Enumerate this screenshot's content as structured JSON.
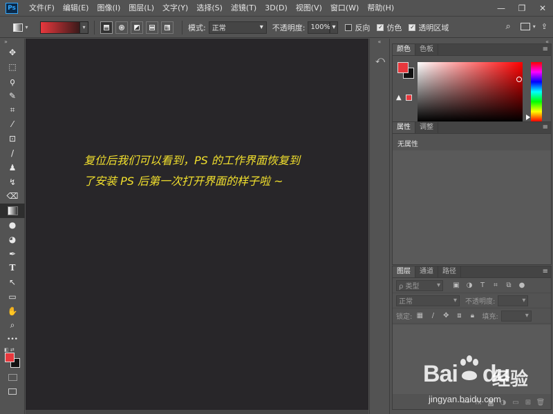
{
  "menubar": {
    "logo": "Ps",
    "items": [
      "文件(F)",
      "编辑(E)",
      "图像(I)",
      "图层(L)",
      "文字(Y)",
      "选择(S)",
      "滤镜(T)",
      "3D(D)",
      "视图(V)",
      "窗口(W)",
      "帮助(H)"
    ],
    "controls": {
      "minimize": "—",
      "restore": "❐",
      "close": "✕"
    }
  },
  "options": {
    "mode_label": "模式:",
    "mode_value": "正常",
    "opacity_label": "不透明度:",
    "opacity_value": "100%",
    "reverse_label": "反向",
    "reverse_checked": false,
    "dither_label": "仿色",
    "dither_checked": true,
    "transparency_label": "透明区域",
    "transparency_checked": true
  },
  "tools": [
    "move-tool",
    "marquee-tool",
    "lasso-tool",
    "quick-select-tool",
    "crop-tool",
    "eyedropper-tool",
    "healing-tool",
    "brush-tool",
    "stamp-tool",
    "history-brush-tool",
    "eraser-tool",
    "gradient-tool",
    "blur-tool",
    "dodge-tool",
    "pen-tool",
    "type-tool",
    "path-select-tool",
    "rectangle-tool",
    "hand-tool",
    "zoom-tool",
    "more-tools"
  ],
  "tool_glyphs": [
    "✥",
    "⬚",
    "ϙ",
    "✎",
    "⌗",
    "⁄",
    "⊡",
    "/",
    "♟",
    "↯",
    "⌫",
    "▦",
    "●",
    "◕",
    "✒",
    "T",
    "↖",
    "▭",
    "✋",
    "⌕",
    "•••"
  ],
  "canvas": {
    "line1": "复位后我们可以看到，PS 的工作界面恢复到",
    "line2": "了安装 PS 后第一次打开界面的样子啦 ~"
  },
  "panels": {
    "color": {
      "tabs": [
        "颜色",
        "色板"
      ],
      "fg": "#e8383d",
      "bg": "#111111"
    },
    "properties": {
      "tabs": [
        "属性",
        "调整"
      ],
      "text": "无属性"
    },
    "layers": {
      "tabs": [
        "图层",
        "通道",
        "路径"
      ],
      "filter_label": "ρ 类型",
      "blend_mode": "正常",
      "opacity_label": "不透明度:",
      "lock_label": "锁定:",
      "fill_label": "填充:"
    }
  },
  "watermark": {
    "brand": "Bai",
    "brand2": "du",
    "suffix": "经验",
    "url": "jingyan.baidu.com"
  },
  "colors": {
    "accent": "#31a8ff",
    "canvas": "#282629",
    "panel": "#535353",
    "text_yellow": "#f2e02d",
    "fg_red": "#e8383d"
  }
}
